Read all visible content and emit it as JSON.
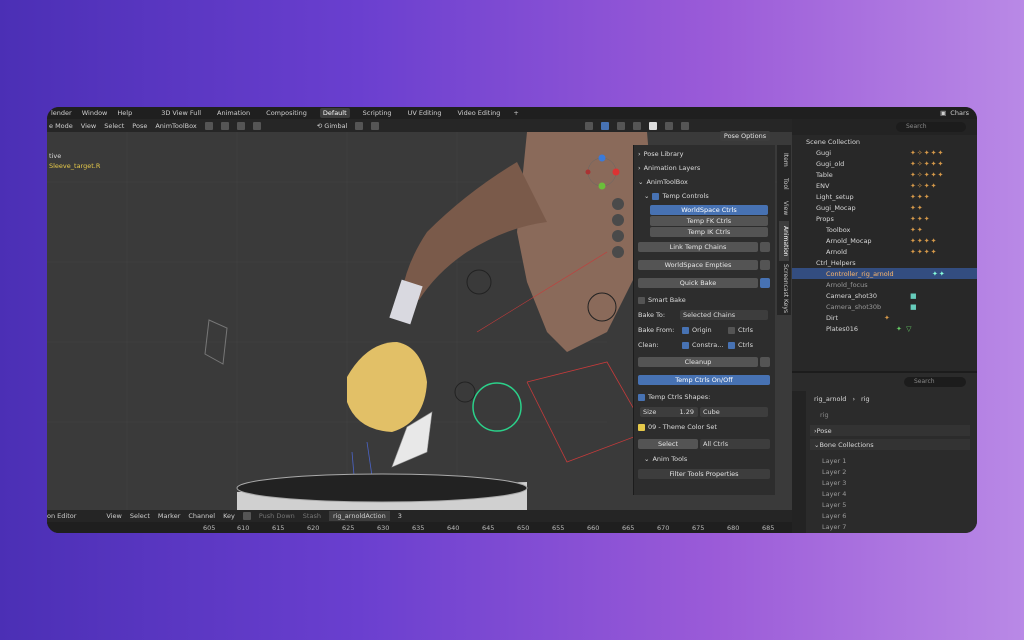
{
  "menubar": {
    "app_menu": "lender",
    "window_menu": "Window",
    "help_menu": "Help",
    "workspaces": [
      "3D View Full",
      "Animation",
      "Compositing",
      "Default",
      "Scripting",
      "UV Editing",
      "Video Editing"
    ],
    "active_workspace": "Default",
    "add_tab": "+",
    "scene_name": "Chars"
  },
  "viewport_header": {
    "mode": "e Mode",
    "view": "View",
    "select": "Select",
    "pose": "Pose",
    "addon": "AnimToolBox",
    "transform": "Gimbal"
  },
  "viewport": {
    "active_label": "tive",
    "bone_label": "Sleeve_target.R"
  },
  "npanel": {
    "pose_library": "Pose Library",
    "animation_layers": "Animation Layers",
    "anim_toolbox": "AnimToolBox",
    "pose_options": "Pose Options",
    "temp_controls": "Temp Controls",
    "worldspace_ctrls": "WorldSpace Ctrls",
    "temp_fk": "Temp FK Ctrls",
    "temp_ik": "Temp IK Ctrls",
    "link_chains": "Link Temp Chains",
    "worldspace_empties": "WorldSpace Empties",
    "quick_bake": "Quick Bake",
    "smart_bake": "Smart Bake",
    "bake_to_label": "Bake To:",
    "bake_to_value": "Selected Chains",
    "bake_from_label": "Bake From:",
    "origin": "Origin",
    "ctrls": "Ctrls",
    "clean_label": "Clean:",
    "constra": "Constra...",
    "ctrls2": "Ctrls",
    "cleanup": "Cleanup",
    "temp_on_off": "Temp Ctrls On/Off",
    "shapes_label": "Temp Ctrls Shapes:",
    "size_label": "Size",
    "size_value": "1.29",
    "shape_value": "Cube",
    "color_set": "09 - Theme Color Set",
    "select": "Select",
    "all_ctrls": "All Ctrls",
    "anim_tools": "Anim Tools",
    "filter_tools": "Filter Tools Properties"
  },
  "vtabs": [
    "Item",
    "Tool",
    "View",
    "Animation",
    "Screencast Keys"
  ],
  "outliner": {
    "search_placeholder": "Search",
    "rows": [
      {
        "name": "Scene Collection",
        "selected": false
      },
      {
        "name": "Gugi",
        "selected": false
      },
      {
        "name": "Gugi_old",
        "selected": false
      },
      {
        "name": "Table",
        "selected": false
      },
      {
        "name": "ENV",
        "selected": false
      },
      {
        "name": "Light_setup",
        "selected": false
      },
      {
        "name": "Gugi_Mocap",
        "selected": false
      },
      {
        "name": "Props",
        "selected": false
      },
      {
        "name": "Toolbox",
        "selected": false
      },
      {
        "name": "Arnold_Mocap",
        "selected": false
      },
      {
        "name": "Arnold",
        "selected": false
      },
      {
        "name": "Ctrl_Helpers",
        "selected": false
      },
      {
        "name": "Controller_rig_arnold",
        "selected": true
      },
      {
        "name": "Arnold_focus",
        "selected": false
      },
      {
        "name": "Camera_shot30",
        "selected": false
      },
      {
        "name": "Camera_shot30b",
        "selected": false
      },
      {
        "name": "Dirt",
        "selected": false
      },
      {
        "name": "Plates016",
        "selected": false
      }
    ]
  },
  "properties": {
    "search_placeholder": "Search",
    "object": "rig_arnold",
    "armature": "rig",
    "data_name": "rig",
    "pose_section": "Pose",
    "bone_collections": "Bone Collections",
    "layers": [
      "Layer 1",
      "Layer 2",
      "Layer 3",
      "Layer 4",
      "Layer 5",
      "Layer 6",
      "Layer 7"
    ]
  },
  "timeline": {
    "editor": "on Editor",
    "view": "View",
    "select": "Select",
    "marker": "Marker",
    "channel": "Channel",
    "key": "Key",
    "push_down": "Push Down",
    "stash": "Stash",
    "action": "rig_arnoldAction",
    "users": "3",
    "frames": [
      "605",
      "610",
      "615",
      "620",
      "625",
      "630",
      "635",
      "640",
      "645",
      "650",
      "655",
      "660",
      "665",
      "670",
      "675",
      "680",
      "685"
    ]
  },
  "colors": {
    "accent_blue": "#4772b3",
    "bone_label_yellow": "#e6c94a",
    "outliner_selected": "#334d80"
  }
}
